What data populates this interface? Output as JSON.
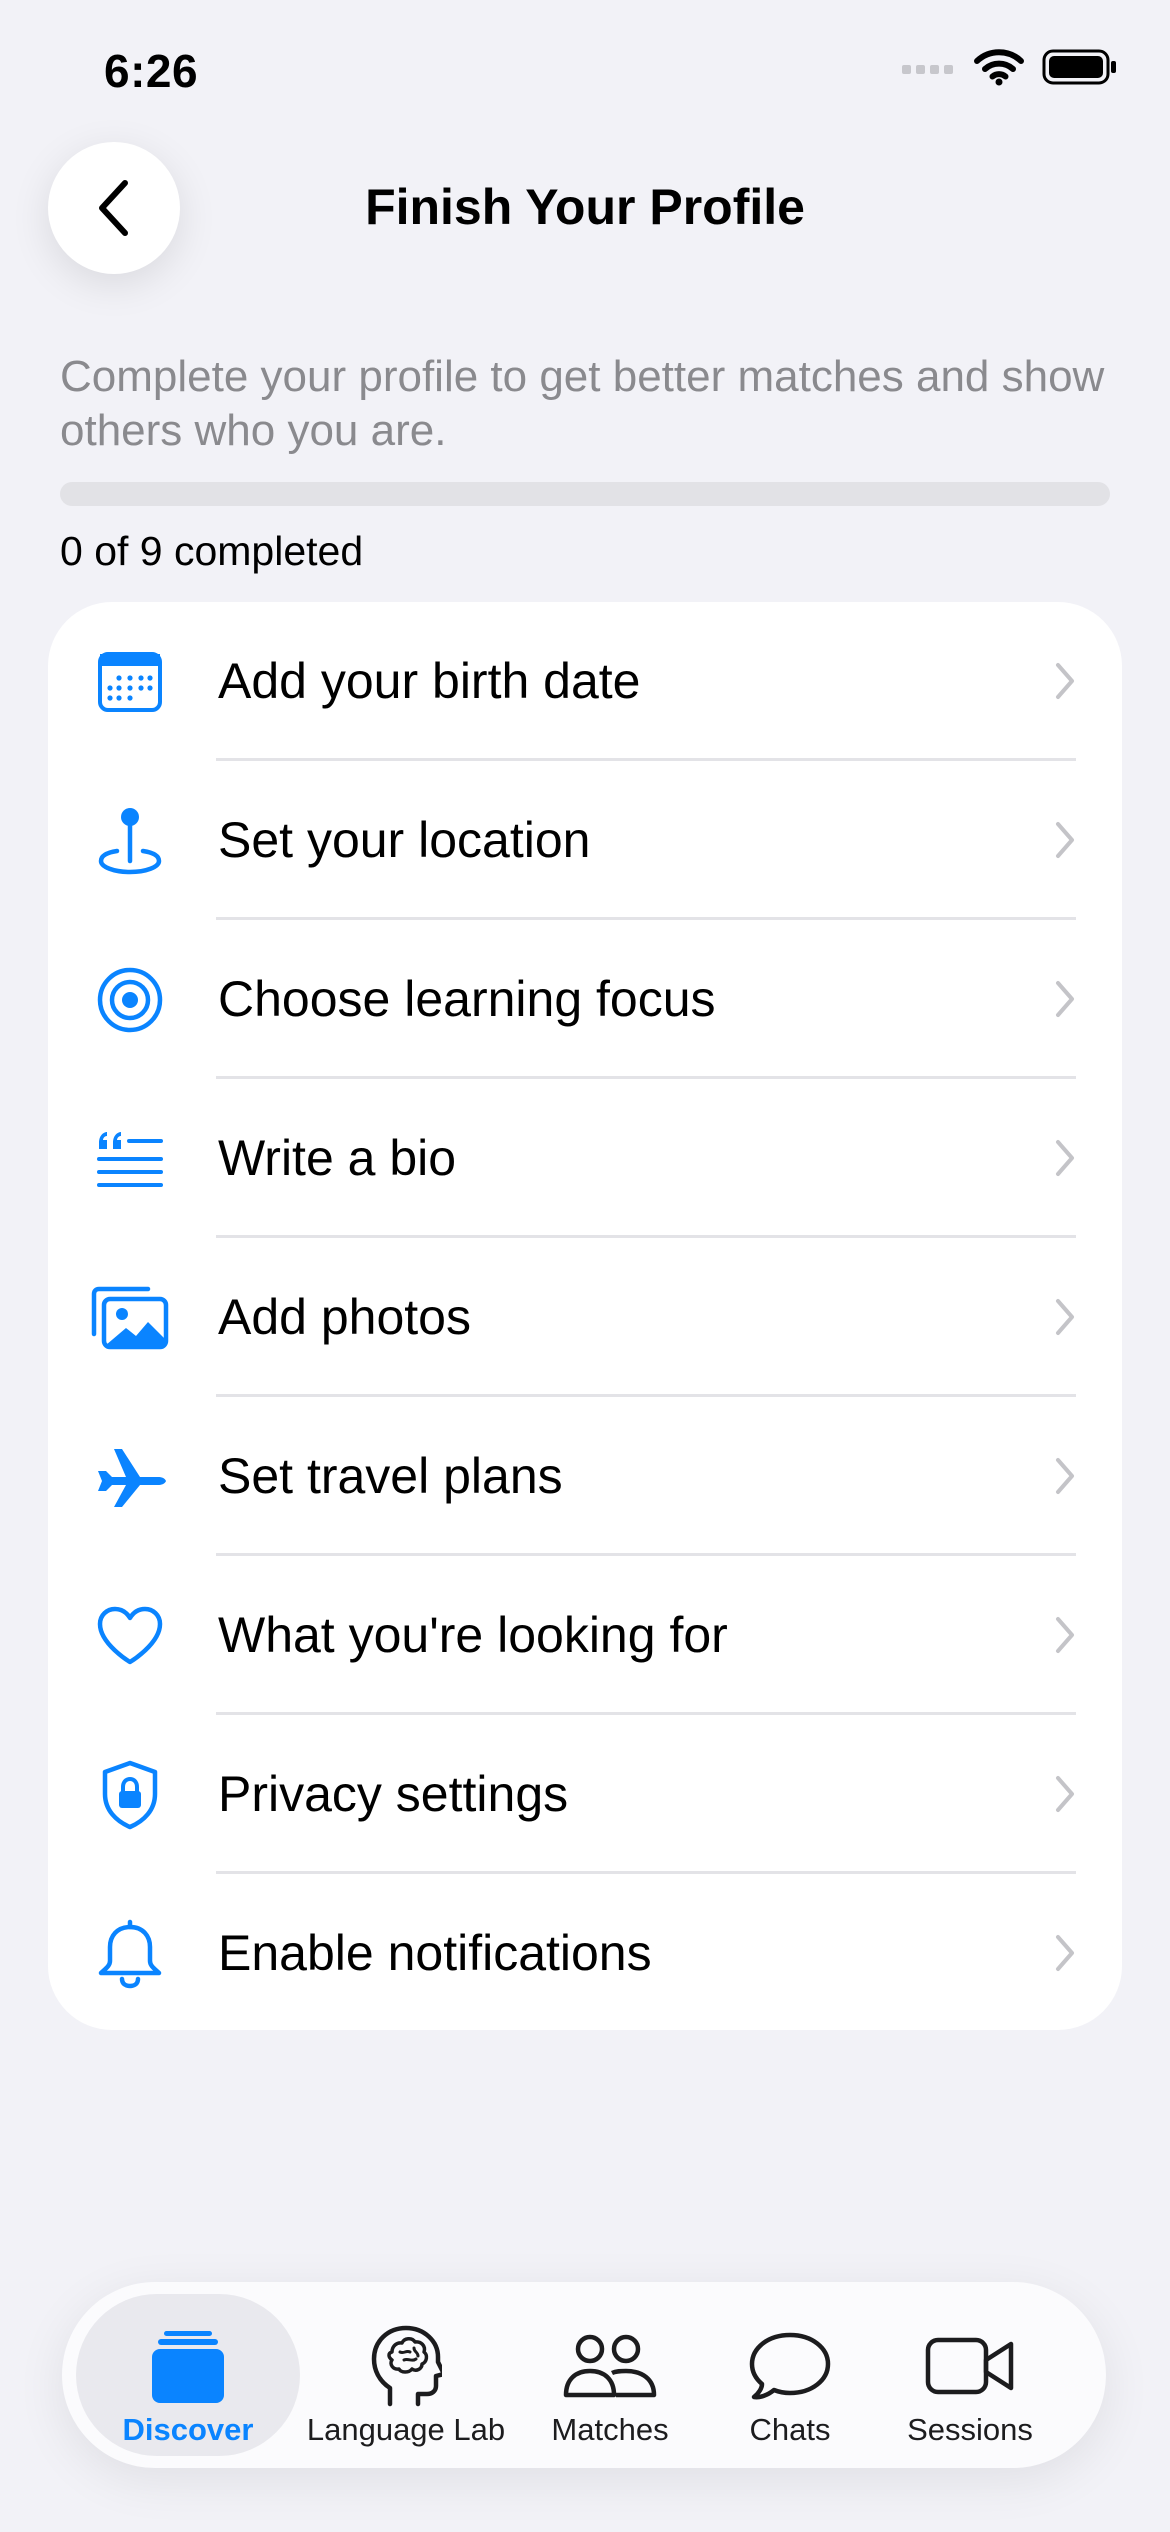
{
  "status_bar": {
    "time": "6:26"
  },
  "header": {
    "title": "Finish Your Profile"
  },
  "intro": {
    "subtitle": "Complete your profile to get better matches and show others who you are.",
    "progress_fraction": 0,
    "progress_text": "0 of 9 completed"
  },
  "checklist": [
    {
      "label": "Add your birth date",
      "icon": "calendar-icon"
    },
    {
      "label": "Set your location",
      "icon": "location-pin-icon"
    },
    {
      "label": "Choose learning focus",
      "icon": "target-icon"
    },
    {
      "label": "Write a bio",
      "icon": "quote-text-icon"
    },
    {
      "label": "Add photos",
      "icon": "photos-icon"
    },
    {
      "label": "Set travel plans",
      "icon": "airplane-icon"
    },
    {
      "label": "What you're looking for",
      "icon": "heart-icon"
    },
    {
      "label": "Privacy settings",
      "icon": "lock-shield-icon"
    },
    {
      "label": "Enable notifications",
      "icon": "bell-icon"
    }
  ],
  "tabbar": {
    "tabs": [
      {
        "label": "Discover",
        "icon": "cards-stack-icon",
        "active": true
      },
      {
        "label": "Language Lab",
        "icon": "brain-head-icon",
        "active": false
      },
      {
        "label": "Matches",
        "icon": "people-icon",
        "active": false
      },
      {
        "label": "Chats",
        "icon": "chat-bubble-icon",
        "active": false
      },
      {
        "label": "Sessions",
        "icon": "video-camera-icon",
        "active": false
      }
    ]
  },
  "colors": {
    "accent": "#0a84ff",
    "background": "#f2f2f7",
    "secondary_text": "#8a8a8e"
  }
}
